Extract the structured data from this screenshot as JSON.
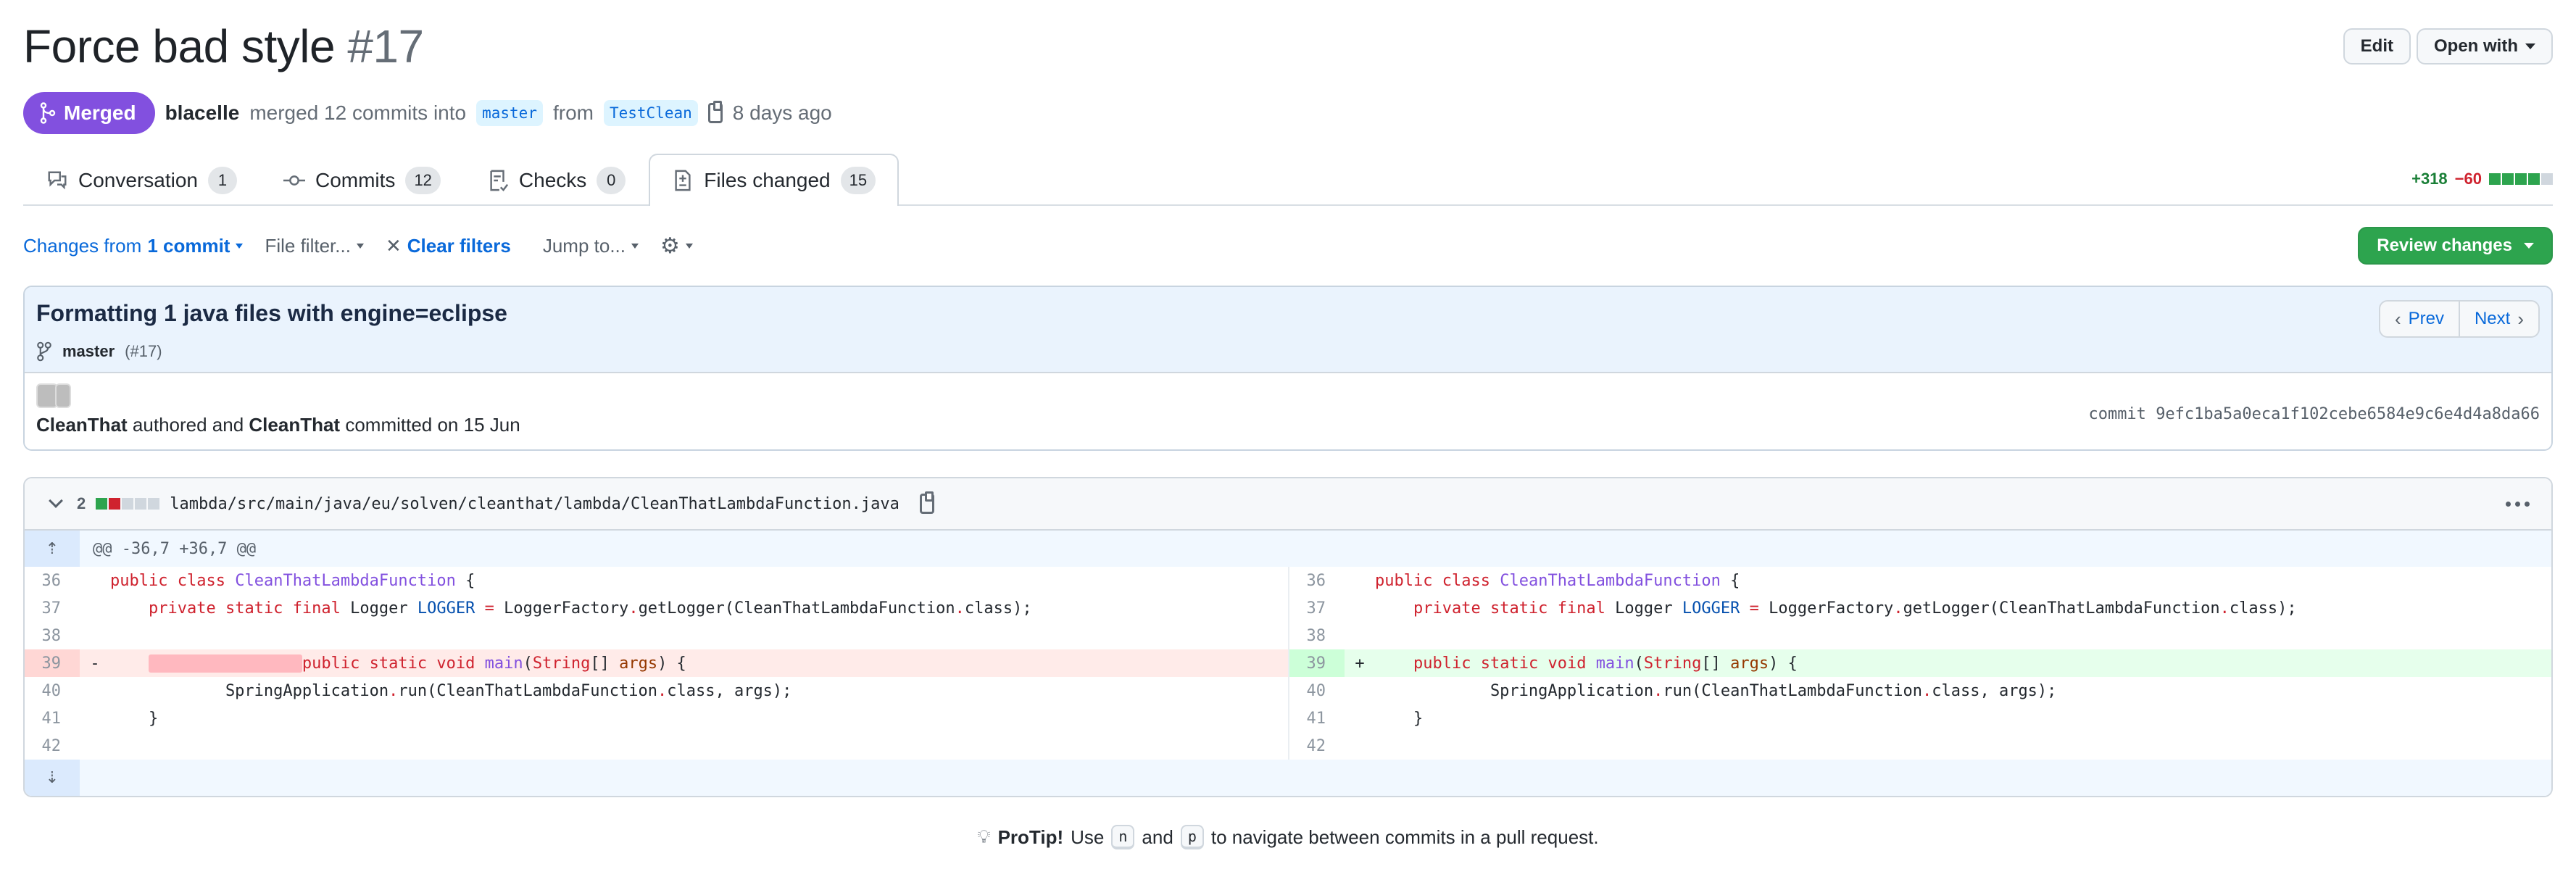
{
  "header": {
    "title": "Force bad style",
    "number": "#17",
    "edit_label": "Edit",
    "open_with_label": "Open with"
  },
  "meta": {
    "state": "Merged",
    "author": "blacelle",
    "merged_text": "merged 12 commits into",
    "base_branch": "master",
    "from_text": "from",
    "head_branch": "TestClean",
    "time_ago": "8 days ago"
  },
  "tabs": [
    {
      "label": "Conversation",
      "count": "1",
      "icon": "comment-discussion-icon"
    },
    {
      "label": "Commits",
      "count": "12",
      "icon": "git-commit-icon"
    },
    {
      "label": "Checks",
      "count": "0",
      "icon": "checklist-icon"
    },
    {
      "label": "Files changed",
      "count": "15",
      "icon": "file-diff-icon",
      "active": true
    }
  ],
  "diffstat": {
    "additions": "+318",
    "deletions": "−60",
    "blocks": [
      "green",
      "green",
      "green",
      "green",
      "neutral"
    ]
  },
  "toolbar": {
    "changes_from_prefix": "Changes from",
    "changes_from_value": "1 commit",
    "file_filter": "File filter...",
    "clear_filters": "Clear filters",
    "jump_to": "Jump to...",
    "review_changes": "Review changes"
  },
  "commit": {
    "title": "Formatting 1 java files with engine=eclipse",
    "branch": "master",
    "pr_ref": "(#17)",
    "prev_label": "Prev",
    "next_label": "Next",
    "author": "CleanThat",
    "authored_text": "authored and",
    "committer": "CleanThat",
    "committed_text": "committed on 15 Jun",
    "sha_label": "commit",
    "sha": "9efc1ba5a0eca1f102cebe6584e9c6e4d4a8da66"
  },
  "file": {
    "change_count": "2",
    "blocks": [
      "green",
      "red",
      "neutral",
      "neutral",
      "neutral"
    ],
    "path": "lambda/src/main/java/eu/solven/cleanthat/lambda/CleanThatLambdaFunction.java",
    "hunk_header": "@@ -36,7 +36,7 @@",
    "left": [
      {
        "n": "36",
        "type": "ctx"
      },
      {
        "n": "37",
        "type": "ctx"
      },
      {
        "n": "38",
        "type": "ctx"
      },
      {
        "n": "39",
        "type": "del",
        "marker": "-"
      },
      {
        "n": "40",
        "type": "ctx"
      },
      {
        "n": "41",
        "type": "ctx"
      },
      {
        "n": "42",
        "type": "ctx"
      }
    ],
    "right": [
      {
        "n": "36",
        "type": "ctx"
      },
      {
        "n": "37",
        "type": "ctx"
      },
      {
        "n": "38",
        "type": "ctx"
      },
      {
        "n": "39",
        "type": "add",
        "marker": "+"
      },
      {
        "n": "40",
        "type": "ctx"
      },
      {
        "n": "41",
        "type": "ctx"
      },
      {
        "n": "42",
        "type": "ctx"
      }
    ],
    "code": {
      "l36": "public class CleanThatLambdaFunction {",
      "l37": "private static final Logger LOGGER = LoggerFactory.getLogger(CleanThatLambdaFunction.class);",
      "l39": "public static void main(String[] args) {",
      "l40": "SpringApplication.run(CleanThatLambdaFunction.class, args);",
      "l41": "}"
    }
  },
  "protip": {
    "label": "ProTip!",
    "use": "Use",
    "key_n": "n",
    "and": "and",
    "key_p": "p",
    "rest": "to navigate between commits in a pull request."
  }
}
